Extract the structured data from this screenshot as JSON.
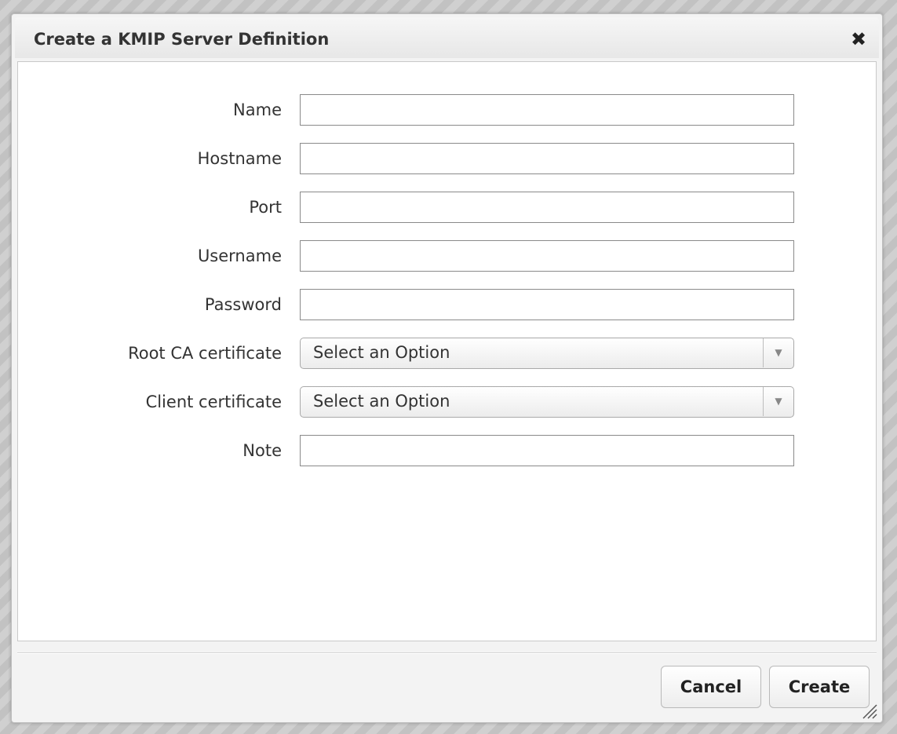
{
  "dialog": {
    "title": "Create a KMIP Server Definition",
    "close_icon": "close-icon"
  },
  "form": {
    "fields": [
      {
        "label": "Name",
        "type": "text",
        "value": ""
      },
      {
        "label": "Hostname",
        "type": "text",
        "value": ""
      },
      {
        "label": "Port",
        "type": "text",
        "value": ""
      },
      {
        "label": "Username",
        "type": "text",
        "value": ""
      },
      {
        "label": "Password",
        "type": "password",
        "value": ""
      },
      {
        "label": "Root CA certificate",
        "type": "select",
        "selected": "Select an Option"
      },
      {
        "label": "Client certificate",
        "type": "select",
        "selected": "Select an Option"
      },
      {
        "label": "Note",
        "type": "text",
        "value": ""
      }
    ]
  },
  "footer": {
    "cancel_label": "Cancel",
    "create_label": "Create"
  }
}
